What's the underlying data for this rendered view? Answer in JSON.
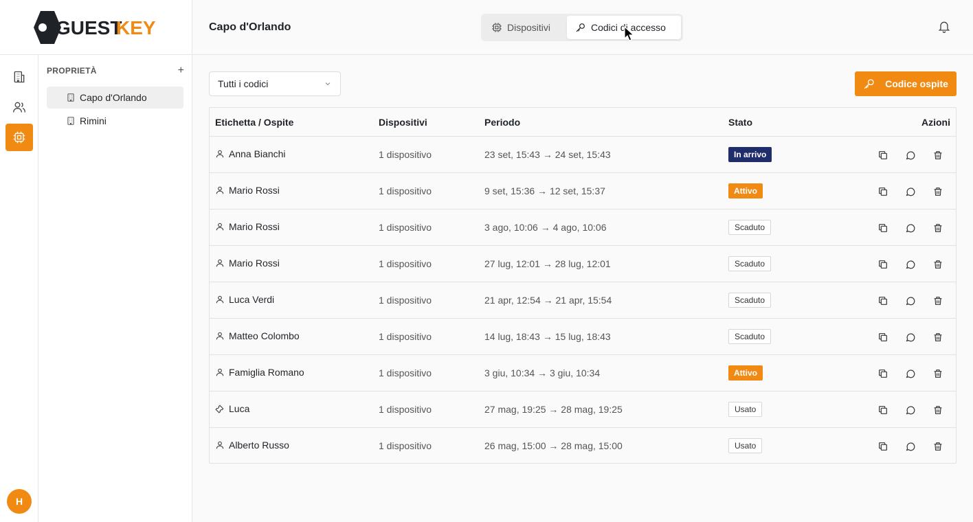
{
  "brand": {
    "name_part1": "GUEST",
    "name_part2": "KEY",
    "accent": "#f08a12",
    "dark": "#1f2328"
  },
  "rail": {
    "items": [
      {
        "icon": "building-icon",
        "active": false
      },
      {
        "icon": "users-icon",
        "active": false
      },
      {
        "icon": "chip-icon",
        "active": true
      }
    ],
    "avatar_initial": "H"
  },
  "properties": {
    "title": "PROPRIETÀ",
    "add_symbol": "+",
    "items": [
      {
        "label": "Capo d'Orlando",
        "selected": true
      },
      {
        "label": "Rimini",
        "selected": false
      }
    ]
  },
  "header": {
    "title": "Capo d'Orlando",
    "tabs": [
      {
        "label": "Dispositivi",
        "icon": "chip-icon",
        "active": false
      },
      {
        "label": "Codici di accesso",
        "icon": "key-icon",
        "active": true
      }
    ],
    "bell_icon": "bell-icon"
  },
  "toolbar": {
    "filter_value": "Tutti i codici",
    "add_label": "Codice ospite"
  },
  "table": {
    "headers": {
      "label": "Etichetta / Ospite",
      "devices": "Dispositivi",
      "period": "Periodo",
      "status": "Stato",
      "actions": "Azioni"
    },
    "rows": [
      {
        "icon": "user-icon",
        "name": "Anna Bianchi",
        "devices": "1 dispositivo",
        "period": "23 set, 15:43 → 24 set, 15:43",
        "status": "In arrivo",
        "status_kind": "arrivo"
      },
      {
        "icon": "user-icon",
        "name": "Mario Rossi",
        "devices": "1 dispositivo",
        "period": "9 set, 15:36 → 12 set, 15:37",
        "status": "Attivo",
        "status_kind": "attivo"
      },
      {
        "icon": "user-icon",
        "name": "Mario Rossi",
        "devices": "1 dispositivo",
        "period": "3 ago, 10:06 → 4 ago, 10:06",
        "status": "Scaduto",
        "status_kind": "neutral"
      },
      {
        "icon": "user-icon",
        "name": "Mario Rossi",
        "devices": "1 dispositivo",
        "period": "27 lug, 12:01 → 28 lug, 12:01",
        "status": "Scaduto",
        "status_kind": "neutral"
      },
      {
        "icon": "user-icon",
        "name": "Luca Verdi",
        "devices": "1 dispositivo",
        "period": "21 apr, 12:54 → 21 apr, 15:54",
        "status": "Scaduto",
        "status_kind": "neutral"
      },
      {
        "icon": "user-icon",
        "name": "Matteo Colombo",
        "devices": "1 dispositivo",
        "period": "14 lug, 18:43 → 15 lug, 18:43",
        "status": "Scaduto",
        "status_kind": "neutral"
      },
      {
        "icon": "user-icon",
        "name": "Famiglia Romano",
        "devices": "1 dispositivo",
        "period": "3 giu, 10:34 → 3 giu, 10:34",
        "status": "Attivo",
        "status_kind": "attivo"
      },
      {
        "icon": "wrench-icon",
        "name": "Luca",
        "devices": "1 dispositivo",
        "period": "27 mag, 19:25 → 28 mag, 19:25",
        "status": "Usato",
        "status_kind": "neutral"
      },
      {
        "icon": "user-icon",
        "name": "Alberto Russo",
        "devices": "1 dispositivo",
        "period": "26 mag, 15:00 → 28 mag, 15:00",
        "status": "Usato",
        "status_kind": "neutral"
      }
    ]
  }
}
